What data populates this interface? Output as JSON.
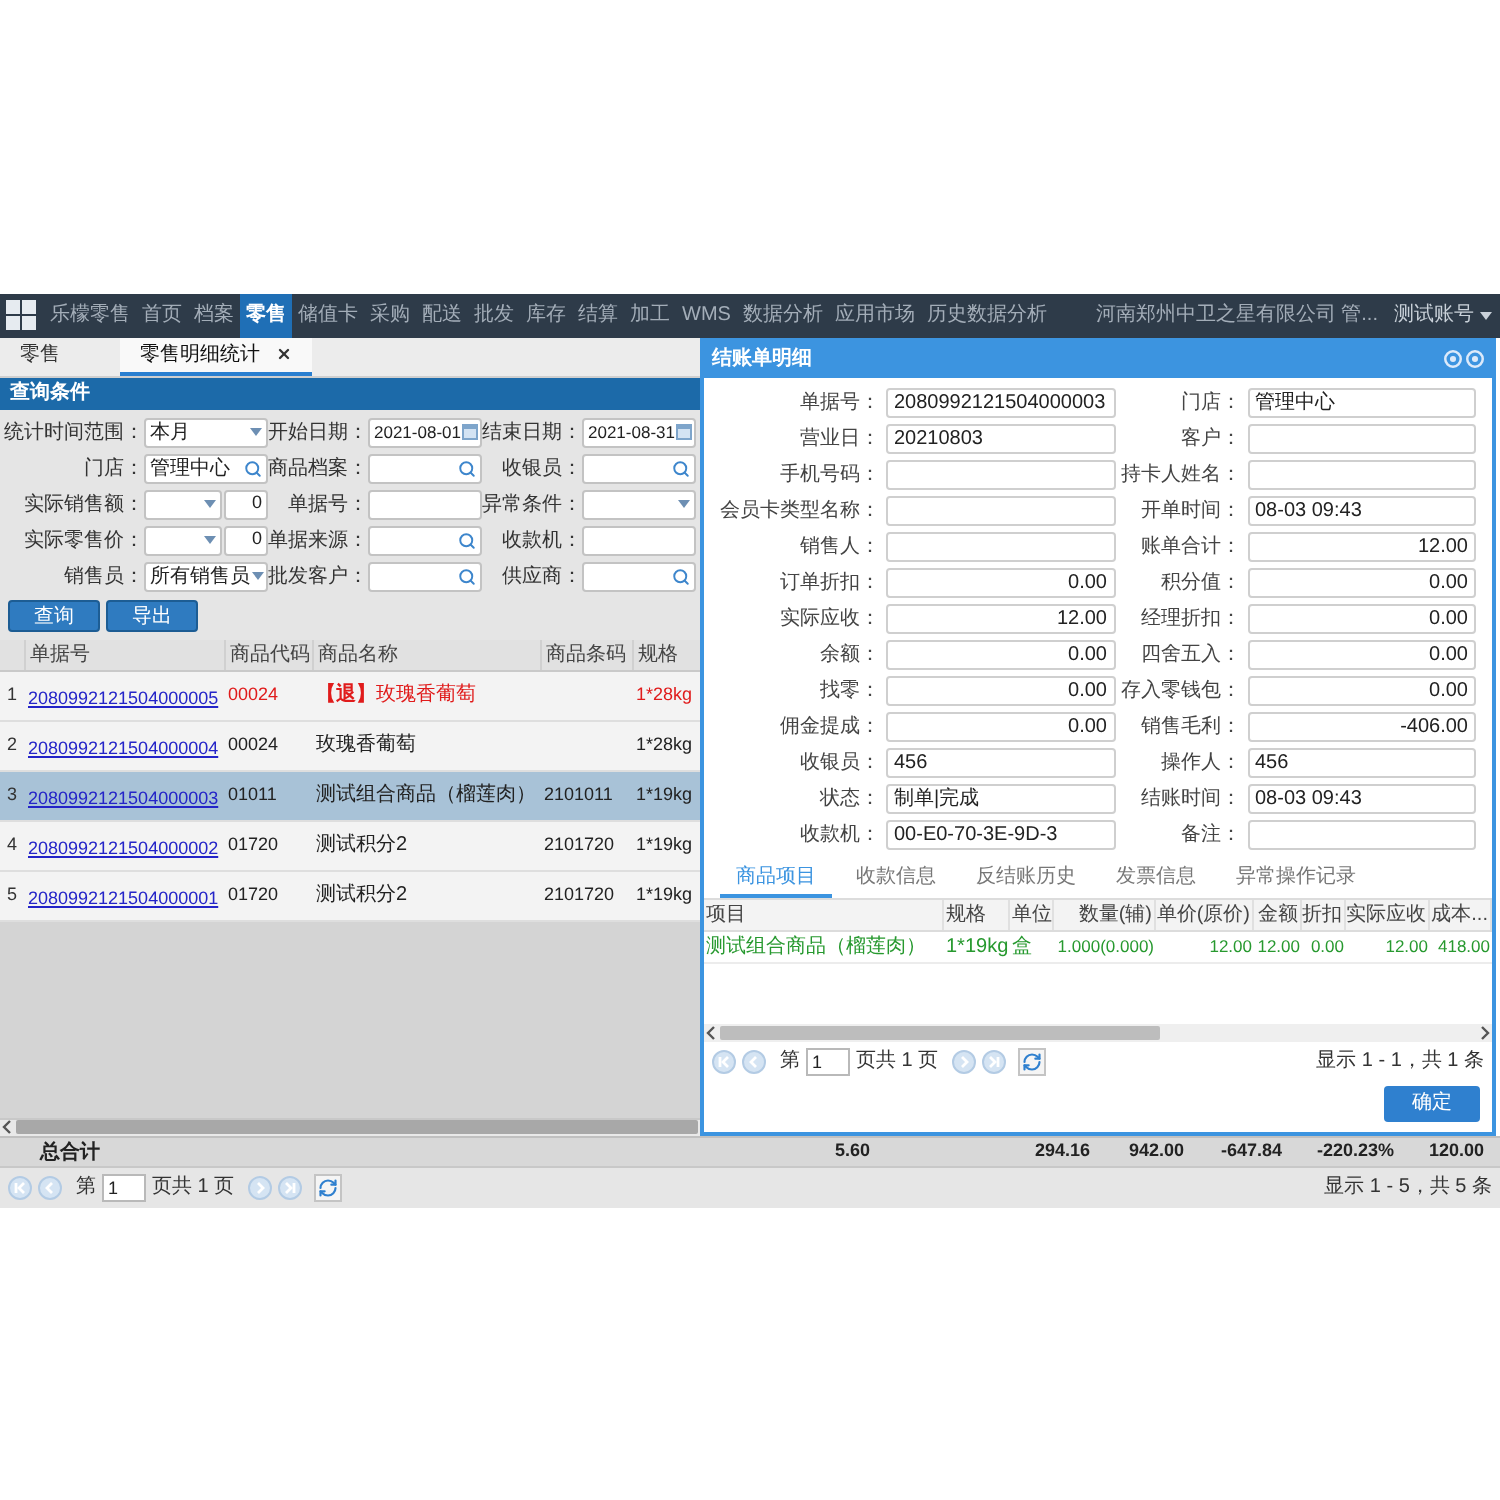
{
  "nav": {
    "items": [
      {
        "label": "乐檬零售",
        "selected": false
      },
      {
        "label": "首页",
        "selected": false
      },
      {
        "label": "档案",
        "selected": false
      },
      {
        "label": "零售",
        "selected": true
      },
      {
        "label": "储值卡",
        "selected": false
      },
      {
        "label": "采购",
        "selected": false
      },
      {
        "label": "配送",
        "selected": false
      },
      {
        "label": "批发",
        "selected": false
      },
      {
        "label": "库存",
        "selected": false
      },
      {
        "label": "结算",
        "selected": false
      },
      {
        "label": "加工",
        "selected": false
      },
      {
        "label": "WMS",
        "selected": false
      },
      {
        "label": "数据分析",
        "selected": false
      },
      {
        "label": "应用市场",
        "selected": false
      },
      {
        "label": "历史数据分析",
        "selected": false
      }
    ],
    "company": "河南郑州中卫之星有限公司 管...",
    "account": "测试账号"
  },
  "page_tabs": [
    {
      "label": "零售",
      "selected": false,
      "closable": false
    },
    {
      "label": "零售明细统计",
      "selected": true,
      "closable": true
    }
  ],
  "query": {
    "title": "查询条件",
    "filters": [
      {
        "label": "统计时间范围：",
        "kind": "select",
        "value": "本月"
      },
      {
        "label": "开始日期：",
        "kind": "date",
        "value": "2021-08-01"
      },
      {
        "label": "结束日期：",
        "kind": "date",
        "value": "2021-08-31"
      },
      {
        "label": "门店：",
        "kind": "lookup",
        "value": "管理中心"
      },
      {
        "label": "商品档案：",
        "kind": "lookup"
      },
      {
        "label": "收银员：",
        "kind": "lookup"
      },
      {
        "label": "实际销售额：",
        "kind": "range",
        "value": "0"
      },
      {
        "label": "单据号：",
        "kind": "text"
      },
      {
        "label": "异常条件：",
        "kind": "select"
      },
      {
        "label": "实际零售价：",
        "kind": "range",
        "value": "0"
      },
      {
        "label": "单据来源：",
        "kind": "lookup"
      },
      {
        "label": "收款机：",
        "kind": "text"
      },
      {
        "label": "销售员：",
        "kind": "select",
        "value": "所有销售员"
      },
      {
        "label": "批发客户：",
        "kind": "lookup"
      },
      {
        "label": "供应商：",
        "kind": "lookup"
      }
    ],
    "buttons": [
      "查询",
      "导出"
    ]
  },
  "table": {
    "columns": [
      "单据号",
      "商品代码",
      "商品名称",
      "商品条码",
      "规格"
    ],
    "rows": [
      {
        "number": "1",
        "document_no": "2080992121504000005",
        "code": "00024",
        "name": "**【退】**玫瑰香葡萄",
        "spec": "1*28kg",
        "returned": true,
        "selected": false
      },
      {
        "number": "2",
        "document_no": "2080992121504000004",
        "code": "00024",
        "name": "玫瑰香葡萄",
        "spec": "1*28kg",
        "returned": false,
        "selected": false
      },
      {
        "number": "3",
        "document_no": "2080992121504000003",
        "code": "01011",
        "name": "测试组合商品（榴莲肉）",
        "barcode": "2101011",
        "spec": "1*19kg",
        "returned": false,
        "selected": true
      },
      {
        "number": "4",
        "document_no": "2080992121504000002",
        "code": "01720",
        "name": "测试积分2",
        "barcode": "2101720",
        "spec": "1*19kg",
        "returned": false,
        "selected": false
      },
      {
        "number": "5",
        "document_no": "2080992121504000001",
        "code": "01720",
        "name": "测试积分2",
        "barcode": "2101720",
        "spec": "1*19kg",
        "returned": false,
        "selected": false
      }
    ]
  },
  "totals": {
    "label": "总合计",
    "values": [
      "5.60",
      "294.16",
      "942.00",
      "-647.84",
      "-220.23%",
      "120.00"
    ]
  },
  "pager": {
    "before": "第",
    "page": "1",
    "after": "页共 1 页",
    "summary": "显示 1 - 5，共 5 条"
  },
  "dialog": {
    "title": "结账单明细",
    "fields": [
      {
        "label": "单据号：",
        "kind": "text",
        "value": "2080992121504000003"
      },
      {
        "label": "门店：",
        "kind": "text",
        "value": "管理中心"
      },
      {
        "label": "营业日：",
        "kind": "text",
        "value": "20210803"
      },
      {
        "label": "客户："
      },
      {
        "label": "手机号码："
      },
      {
        "label": "持卡人姓名："
      },
      {
        "label": "会员卡类型名称："
      },
      {
        "label": "开单时间：",
        "kind": "text",
        "value": "08-03 09:43"
      },
      {
        "label": "销售人："
      },
      {
        "label": "账单合计：",
        "kind": "number",
        "value": "12.00"
      },
      {
        "label": "订单折扣：",
        "kind": "number",
        "value": "0.00"
      },
      {
        "label": "积分值：",
        "kind": "number",
        "value": "0.00"
      },
      {
        "label": "实际应收：",
        "kind": "number",
        "value": "12.00"
      },
      {
        "label": "经理折扣：",
        "kind": "number",
        "value": "0.00"
      },
      {
        "label": "余额：",
        "kind": "number",
        "value": "0.00"
      },
      {
        "label": "四舍五入：",
        "kind": "number",
        "value": "0.00"
      },
      {
        "label": "找零：",
        "kind": "number",
        "value": "0.00"
      },
      {
        "label": "存入零钱包：",
        "kind": "number",
        "value": "0.00"
      },
      {
        "label": "佣金提成：",
        "kind": "number",
        "value": "0.00"
      },
      {
        "label": "销售毛利：",
        "kind": "number",
        "value": "-406.00"
      },
      {
        "label": "收银员：",
        "kind": "text",
        "value": "456"
      },
      {
        "label": "操作人：",
        "kind": "text",
        "value": "456"
      },
      {
        "label": "状态：",
        "kind": "text",
        "value": "制单|完成"
      },
      {
        "label": "结账时间：",
        "kind": "text",
        "value": "08-03 09:43"
      },
      {
        "label": "收款机：",
        "kind": "text",
        "value": "00-E0-70-3E-9D-3"
      },
      {
        "label": "备注："
      }
    ],
    "tabs": [
      {
        "label": "商品项目",
        "selected": true
      },
      {
        "label": "收款信息",
        "selected": false
      },
      {
        "label": "反结账历史",
        "selected": false
      },
      {
        "label": "发票信息",
        "selected": false
      },
      {
        "label": "异常操作记录",
        "selected": false
      }
    ],
    "table": {
      "columns": [
        {
          "label": "项目",
          "kind": "text"
        },
        {
          "label": "规格",
          "kind": "text"
        },
        {
          "label": "单位",
          "kind": "text"
        },
        {
          "label": "数量(辅)",
          "kind": "number"
        },
        {
          "label": "单价(原价)",
          "kind": "number"
        },
        {
          "label": "金额",
          "kind": "number"
        },
        {
          "label": "折扣",
          "kind": "number"
        },
        {
          "label": "实际应收",
          "kind": "number"
        },
        {
          "label": "成本...",
          "kind": "number"
        }
      ],
      "rows": [
        {
          "cells": [
            "测试组合商品（榴莲肉）",
            "1*19kg",
            "盒",
            "1.000(0.000)",
            "12.00",
            "12.00",
            "0.00",
            "12.00",
            "418.00"
          ]
        }
      ]
    },
    "pager": {
      "before": "第",
      "page": "1",
      "after": "页共 1 页",
      "summary": "显示 1 - 1，共 1 条"
    },
    "buttons": [
      "确定"
    ]
  }
}
